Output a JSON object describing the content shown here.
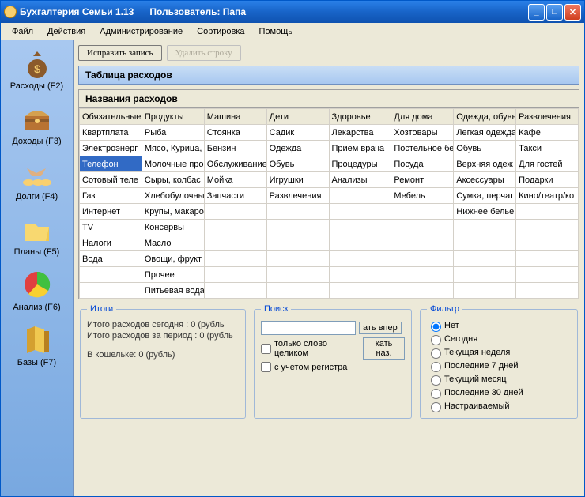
{
  "window": {
    "app_title": "Бухгалтерия Семьи 1.13",
    "user_label": "Пользователь: Папа"
  },
  "menu": [
    "Файл",
    "Действия",
    "Администрирование",
    "Сортировка",
    "Помощь"
  ],
  "sidebar": [
    {
      "label": "Расходы (F2)",
      "icon": "money-bag"
    },
    {
      "label": "Доходы (F3)",
      "icon": "chest"
    },
    {
      "label": "Долги (F4)",
      "icon": "handshake"
    },
    {
      "label": "Планы (F5)",
      "icon": "folder"
    },
    {
      "label": "Анализ (F6)",
      "icon": "pie-chart"
    },
    {
      "label": "Базы (F7)",
      "icon": "books"
    }
  ],
  "toolbar": {
    "edit_label": "Исправить запись",
    "delete_label": "Удалить строку"
  },
  "sections": {
    "table_title": "Таблица расходов",
    "names_title": "Названия расходов"
  },
  "table": {
    "headers": [
      "Обязательные",
      "Продукты",
      "Машина",
      "Дети",
      "Здоровье",
      "Для дома",
      "Одежда, обувь",
      "Развлечения"
    ],
    "rows": [
      [
        "Квартплата",
        "Рыба",
        "Стоянка",
        "Садик",
        "Лекарства",
        "Хозтовары",
        "Легкая одежда",
        "Кафе"
      ],
      [
        "Электроэнерг",
        "Мясо, Курица,",
        "Бензин",
        "Одежда",
        "Прием врача",
        "Постельное бе",
        "Обувь",
        "Такси"
      ],
      [
        "Телефон",
        "Молочные про",
        "Обслуживание",
        "Обувь",
        "Процедуры",
        "Посуда",
        "Верхняя одеж",
        "Для гостей"
      ],
      [
        "Сотовый теле",
        "Сыры, колбас",
        "Мойка",
        "Игрушки",
        "Анализы",
        "Ремонт",
        "Аксессуары",
        "Подарки"
      ],
      [
        "Газ",
        "Хлебобулочны",
        "Запчасти",
        "Развлечения",
        "",
        "Мебель",
        "Сумка, перчат",
        "Кино/театр/ко"
      ],
      [
        "Интернет",
        "Крупы, макаро",
        "",
        "",
        "",
        "",
        "Нижнее белье",
        ""
      ],
      [
        "TV",
        "Консервы",
        "",
        "",
        "",
        "",
        "",
        ""
      ],
      [
        "Налоги",
        "Масло",
        "",
        "",
        "",
        "",
        "",
        ""
      ],
      [
        "Вода",
        "Овощи, фрукт",
        "",
        "",
        "",
        "",
        "",
        ""
      ],
      [
        "",
        "Прочее",
        "",
        "",
        "",
        "",
        "",
        ""
      ],
      [
        "",
        "Питьевая вода",
        "",
        "",
        "",
        "",
        "",
        ""
      ]
    ],
    "selected": {
      "row": 2,
      "col": 0
    }
  },
  "totals": {
    "legend": "Итоги",
    "today": "Итого расходов сегодня : 0 (рубль",
    "period": "Итого расходов за период : 0 (рубль",
    "wallet": "В кошельке: 0 (рубль)"
  },
  "search": {
    "legend": "Поиск",
    "placeholder": "",
    "btn_fwd": "ать впер",
    "btn_back": "кать наз.",
    "whole_word": "только слово целиком",
    "match_case": "с учетом регистра"
  },
  "filter": {
    "legend": "Фильтр",
    "options": [
      "Нет",
      "Сегодня",
      "Текущая неделя",
      "Последние 7 дней",
      "Текущий месяц",
      "Последние 30 дней",
      "Настраиваемый"
    ],
    "selected": 0
  }
}
